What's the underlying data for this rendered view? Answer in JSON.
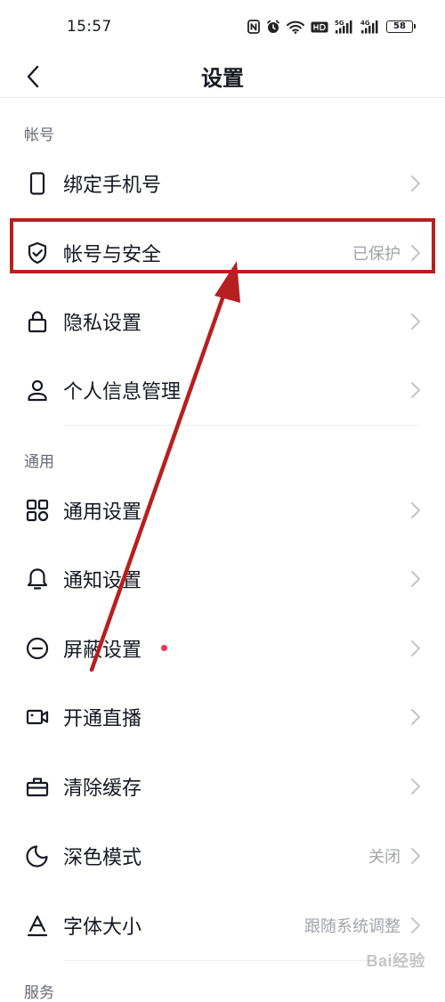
{
  "status_bar": {
    "time": "15:57",
    "battery": "58",
    "icons": [
      "nfc-icon",
      "alarm-icon",
      "wifi-icon",
      "hd-icon",
      "signal-5g-icon",
      "signal-4g-icon",
      "battery-icon"
    ]
  },
  "nav": {
    "title": "设置",
    "back_icon": "chevron-left-icon"
  },
  "sections": {
    "account": {
      "header": "帐号",
      "items": [
        {
          "label": "绑定手机号",
          "value": "",
          "icon": "phone-icon"
        },
        {
          "label": "帐号与安全",
          "value": "已保护",
          "icon": "shield-check-icon"
        },
        {
          "label": "隐私设置",
          "value": "",
          "icon": "lock-icon"
        },
        {
          "label": "个人信息管理",
          "value": "",
          "icon": "person-icon"
        }
      ]
    },
    "general": {
      "header": "通用",
      "items": [
        {
          "label": "通用设置",
          "value": "",
          "icon": "grid-icon"
        },
        {
          "label": "通知设置",
          "value": "",
          "icon": "bell-icon"
        },
        {
          "label": "屏蔽设置",
          "value": "",
          "icon": "block-icon",
          "badge": "red-dot"
        },
        {
          "label": "开通直播",
          "value": "",
          "icon": "video-camera-icon"
        },
        {
          "label": "清除缓存",
          "value": "",
          "icon": "briefcase-icon"
        },
        {
          "label": "深色模式",
          "value": "关闭",
          "icon": "moon-icon"
        },
        {
          "label": "字体大小",
          "value": "跟随系统调整",
          "icon": "font-size-icon"
        }
      ]
    },
    "service": {
      "header": "服务"
    }
  },
  "colors": {
    "highlight_border": "#b81f20",
    "arrow": "#b81f20",
    "badge": "#fe2c55",
    "text_primary": "#161823",
    "text_secondary": "#a2a4ab"
  },
  "watermark": "Bai经验"
}
